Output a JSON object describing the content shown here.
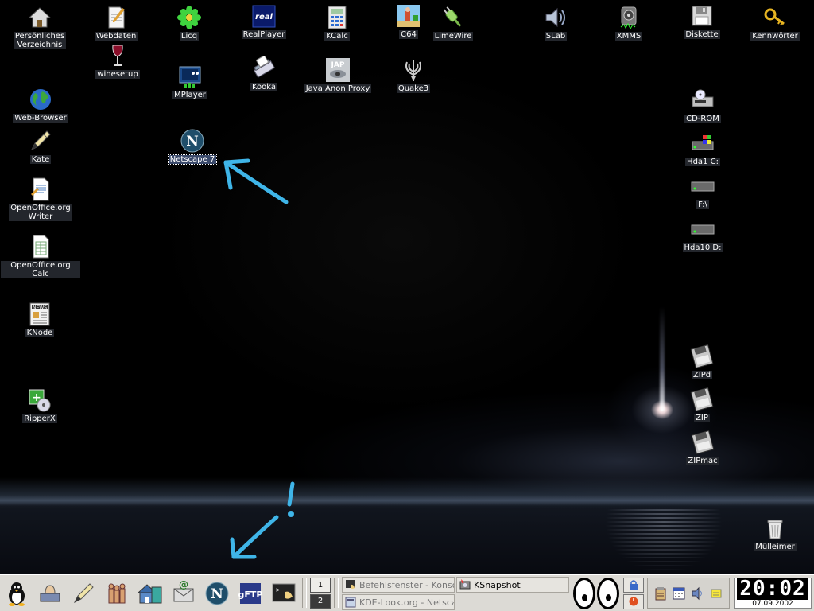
{
  "desktop": {
    "icons": [
      {
        "id": "home",
        "label": "Persönliches\nVerzeichnis",
        "icon": "home-folder-icon"
      },
      {
        "id": "webdaten",
        "label": "Webdaten",
        "icon": "document-icon"
      },
      {
        "id": "licq",
        "label": "Licq",
        "icon": "licq-flower-icon"
      },
      {
        "id": "realplayer",
        "label": "RealPlayer",
        "icon": "realplayer-icon"
      },
      {
        "id": "kcalc",
        "label": "KCalc",
        "icon": "calculator-icon"
      },
      {
        "id": "c64",
        "label": "C64",
        "icon": "c64-icon"
      },
      {
        "id": "limewire",
        "label": "LimeWire",
        "icon": "plug-icon"
      },
      {
        "id": "slab",
        "label": "SLab",
        "icon": "speaker-icon"
      },
      {
        "id": "xmms",
        "label": "XMMS",
        "icon": "xmms-icon"
      },
      {
        "id": "diskette",
        "label": "Diskette",
        "icon": "floppy-icon"
      },
      {
        "id": "kennwoerter",
        "label": "Kennwörter",
        "icon": "key-icon"
      },
      {
        "id": "winesetup",
        "label": "winesetup",
        "icon": "wine-glass-icon"
      },
      {
        "id": "mplayer",
        "label": "MPlayer",
        "icon": "mplayer-icon"
      },
      {
        "id": "kooka",
        "label": "Kooka",
        "icon": "scanner-icon"
      },
      {
        "id": "jap",
        "label": "Java Anon Proxy",
        "icon": "jap-icon"
      },
      {
        "id": "quake3",
        "label": "Quake3",
        "icon": "quake-icon"
      },
      {
        "id": "webbrowser",
        "label": "Web-Browser",
        "icon": "globe-icon"
      },
      {
        "id": "cdrom",
        "label": "CD-ROM",
        "icon": "cdrom-drive-icon"
      },
      {
        "id": "hda1",
        "label": "Hda1 C:",
        "icon": "windows-drive-icon"
      },
      {
        "id": "kate",
        "label": "Kate",
        "icon": "kate-pen-icon"
      },
      {
        "id": "netscape",
        "label": "Netscape 7",
        "icon": "netscape-icon"
      },
      {
        "id": "oowriter",
        "label": "OpenOffice.org\nWriter",
        "icon": "writer-document-icon"
      },
      {
        "id": "fdrive",
        "label": "F:\\",
        "icon": "hard-drive-icon"
      },
      {
        "id": "hda10",
        "label": "Hda10 D:",
        "icon": "hard-drive-icon"
      },
      {
        "id": "oocalc",
        "label": "OpenOffice.org Calc",
        "icon": "calc-spreadsheet-icon"
      },
      {
        "id": "knode",
        "label": "KNode",
        "icon": "news-icon"
      },
      {
        "id": "zipd",
        "label": "ZIPd",
        "icon": "zip-disk-icon"
      },
      {
        "id": "ripperx",
        "label": "RipperX",
        "icon": "ripper-icon"
      },
      {
        "id": "zip",
        "label": "ZIP",
        "icon": "zip-disk-icon"
      },
      {
        "id": "zipmac",
        "label": "ZIPmac",
        "icon": "zip-disk-icon"
      },
      {
        "id": "trash",
        "label": "Mülleimer",
        "icon": "trash-icon"
      }
    ],
    "annotations": [
      "Netscape 7",
      "!"
    ],
    "colors": {
      "annotation": "#3fb5e8",
      "label_bg": "#23262c",
      "selected_label_bg": "#3b4a6b"
    }
  },
  "kicker": {
    "launchers": [
      {
        "id": "kmenu",
        "icon": "penguin-kmenu-icon"
      },
      {
        "id": "desktop-access",
        "icon": "hand-desktop-icon"
      },
      {
        "id": "kate",
        "icon": "kate-pen-icon"
      },
      {
        "id": "users",
        "icon": "family-icon"
      },
      {
        "id": "filemanager",
        "icon": "house-icon"
      },
      {
        "id": "mail",
        "icon": "mail-icon"
      },
      {
        "id": "netscape",
        "icon": "netscape-icon"
      },
      {
        "id": "gftp",
        "icon": "gftp-icon"
      },
      {
        "id": "konsole",
        "icon": "terminal-shell-icon"
      }
    ],
    "pager": [
      "1",
      "2"
    ],
    "active_desktop": "2",
    "tasks": [
      {
        "label": "Befehlsfenster - Konsole",
        "icon": "terminal-task-icon",
        "active": false
      },
      {
        "label": "KSnapshot",
        "icon": "ksnapshot-icon",
        "active": true
      },
      {
        "label": "KDE-Look.org - Netscape",
        "icon": "netscape-task-icon",
        "active": false
      }
    ],
    "clock": {
      "time": "20:02",
      "date": "07.09.2002"
    }
  }
}
